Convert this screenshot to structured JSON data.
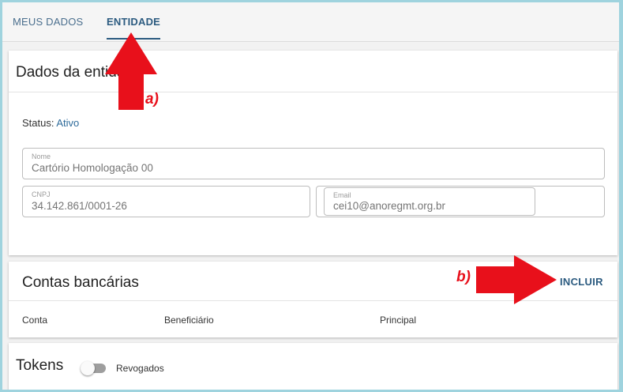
{
  "tabs": [
    {
      "label": "MEUS DADOS",
      "active": false
    },
    {
      "label": "ENTIDADE",
      "active": true
    }
  ],
  "entity_card": {
    "title": "Dados da entidade",
    "status_label": "Status:",
    "status_value": "Ativo",
    "fields": {
      "nome": {
        "label": "Nome",
        "value": "Cartório Homologação 00"
      },
      "cnpj": {
        "label": "CNPJ",
        "value": "34.142.861/0001-26"
      },
      "email": {
        "label": "Email",
        "value": "cei10@anoregmt.org.br"
      }
    }
  },
  "bank_card": {
    "title": "Contas bancárias",
    "add_label": "INCLUIR",
    "columns": [
      "Conta",
      "Beneficiário",
      "Principal"
    ]
  },
  "tokens_card": {
    "title": "Tokens",
    "toggle_label": "Revogados",
    "toggle_on": false
  },
  "annotations": {
    "a": "a)",
    "b": "b)"
  },
  "colors": {
    "accent": "#2c5b80",
    "annotation": "#e8101b",
    "status_value": "#2d6a9a"
  },
  "icons": [
    "arrow-up-annotation",
    "arrow-right-annotation",
    "toggle-switch"
  ]
}
